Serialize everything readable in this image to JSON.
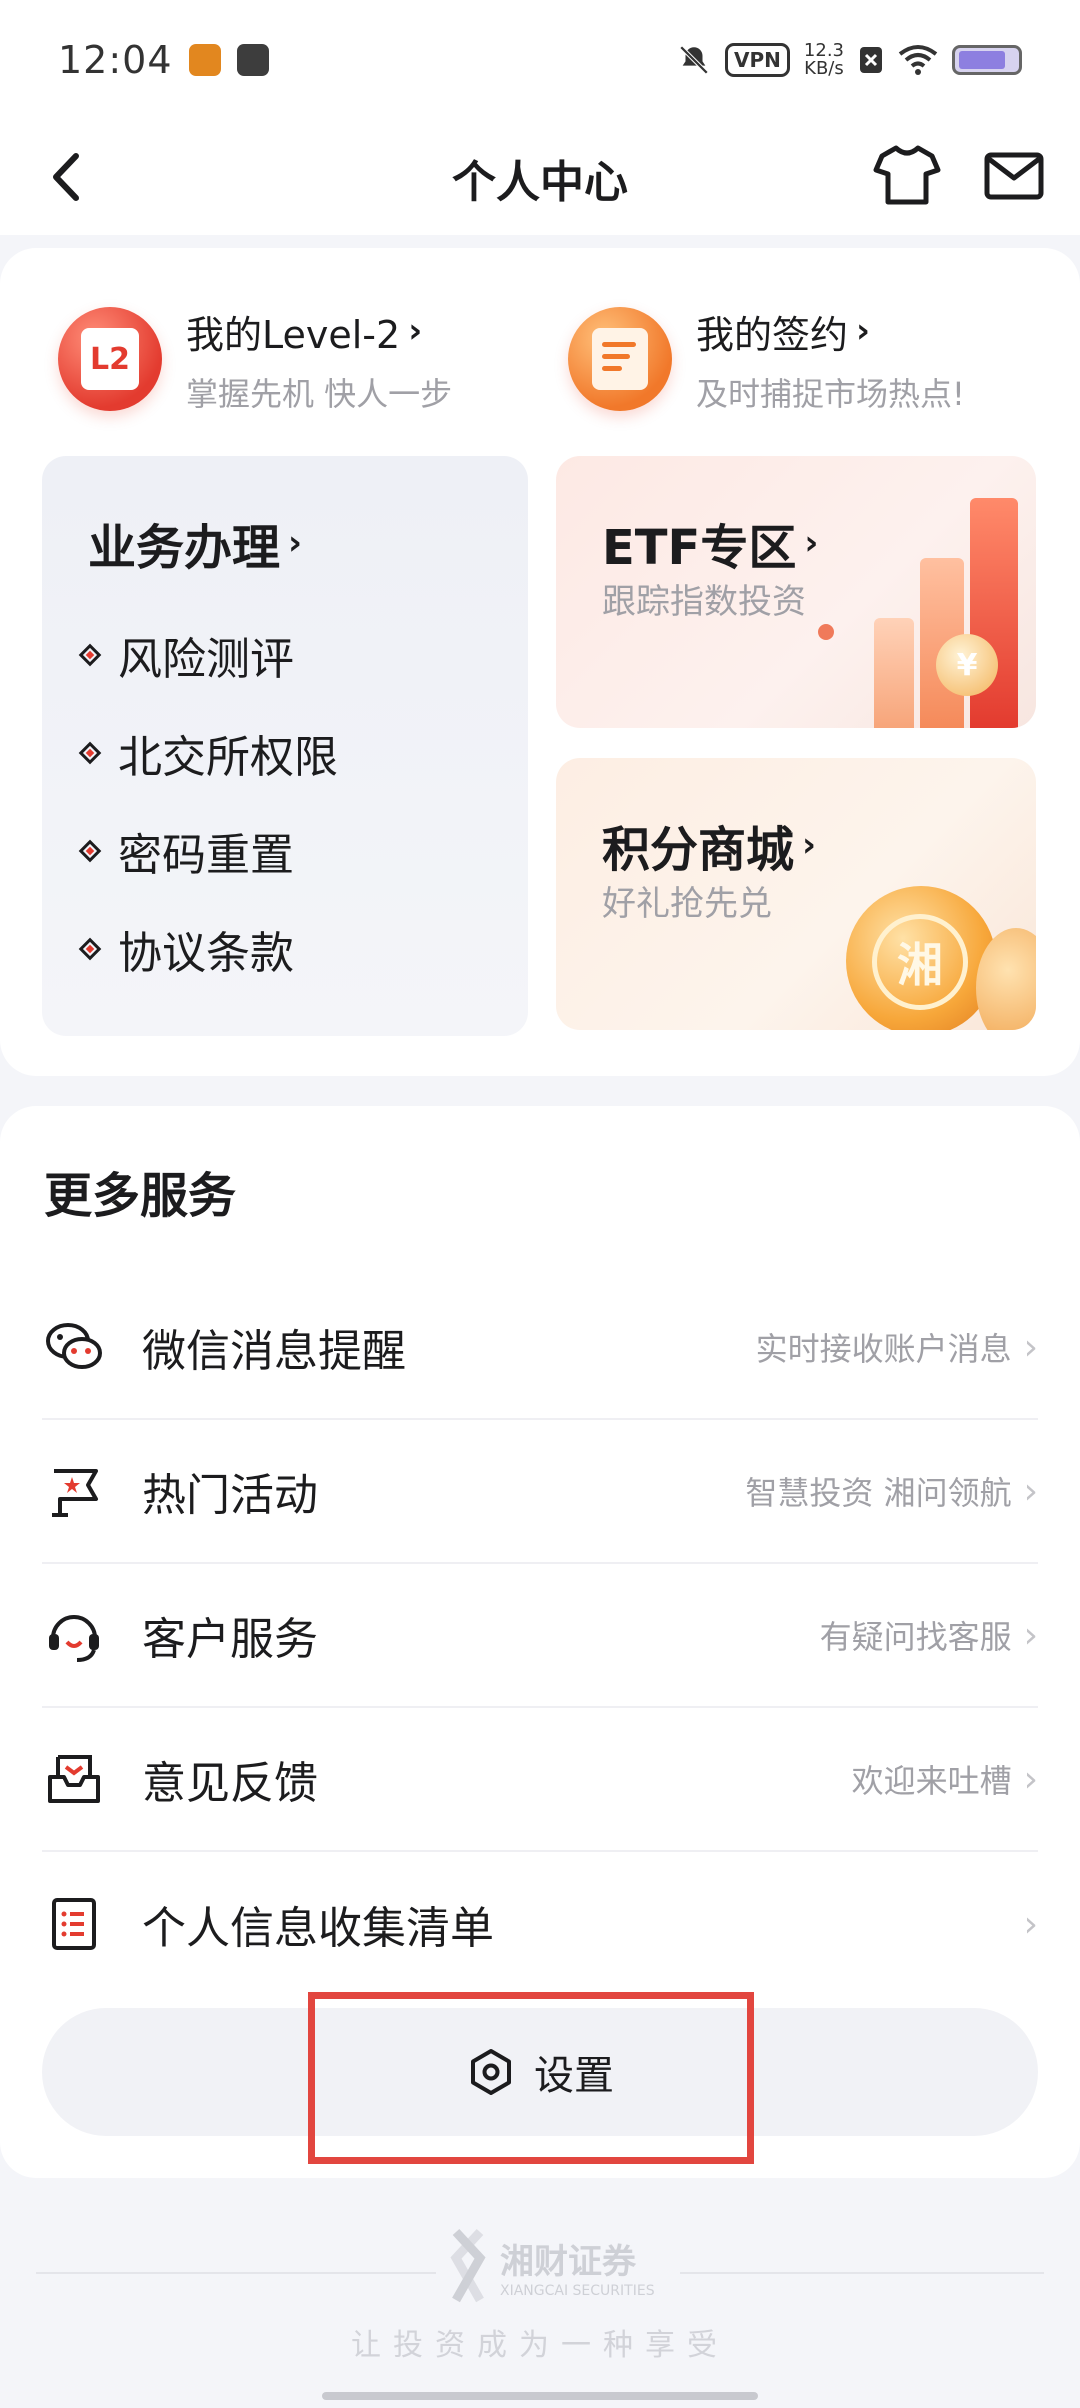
{
  "status_bar": {
    "time": "12:04",
    "vpn": "VPN",
    "net_speed_value": "12.3",
    "net_speed_unit": "KB/s"
  },
  "header": {
    "title": "个人中心"
  },
  "quick_links": [
    {
      "title": "我的Level-2",
      "subtitle": "掌握先机 快人一步",
      "icon": "level2-icon",
      "badge": "L2"
    },
    {
      "title": "我的签约",
      "subtitle": "及时捕捉市场热点!",
      "icon": "contract-icon"
    }
  ],
  "business": {
    "title": "业务办理",
    "items": [
      "风险测评",
      "北交所权限",
      "密码重置",
      "协议条款"
    ]
  },
  "etf": {
    "title": "ETF专区",
    "subtitle": "跟踪指数投资",
    "coin_mark": "¥"
  },
  "mall": {
    "title": "积分商城",
    "subtitle": "好礼抢先兑",
    "coin_mark": "湘"
  },
  "more_services": {
    "title": "更多服务",
    "items": [
      {
        "label": "微信消息提醒",
        "hint": "实时接收账户消息",
        "icon": "wechat-icon"
      },
      {
        "label": "热门活动",
        "hint": "智慧投资 湘问领航",
        "icon": "flag-icon"
      },
      {
        "label": "客户服务",
        "hint": "有疑问找客服",
        "icon": "headset-icon"
      },
      {
        "label": "意见反馈",
        "hint": "欢迎来吐槽",
        "icon": "inbox-icon"
      },
      {
        "label": "个人信息收集清单",
        "hint": "",
        "icon": "list-icon"
      }
    ]
  },
  "settings": {
    "label": "设置",
    "icon": "settings-hexagon-icon"
  },
  "footer": {
    "brand": "湘财证券",
    "brand_en": "XIANGCAI SECURITIES",
    "slogan": "让投资成为一种享受"
  },
  "colors": {
    "accent_red": "#e33b2f",
    "highlight_box": "#e2463f",
    "hint_gray": "#a0a0a6"
  }
}
